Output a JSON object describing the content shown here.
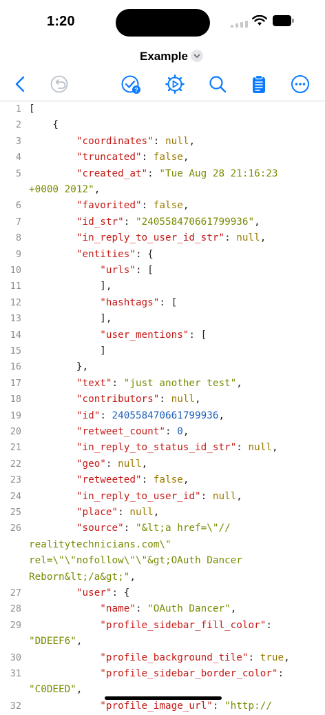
{
  "status_bar": {
    "time": "1:20"
  },
  "header": {
    "title": "Example"
  },
  "toolbar": {
    "icons": [
      "back-chevron-icon",
      "undo-icon",
      "validate-icon",
      "settings-gear-icon",
      "search-icon",
      "clipboard-icon",
      "more-icon"
    ]
  },
  "colors": {
    "accent": "#0a7aff",
    "key": "#c41a16",
    "string": "#7a8a00",
    "number": "#1c5fb8",
    "line_number": "#8e8e93"
  },
  "code_lines": [
    {
      "n": "1",
      "parts": [
        [
          "p",
          "["
        ]
      ]
    },
    {
      "n": "2",
      "parts": [
        [
          "p",
          "    {"
        ]
      ]
    },
    {
      "n": "3",
      "parts": [
        [
          "p",
          "        "
        ],
        [
          "k",
          "\"coordinates\""
        ],
        [
          "p",
          ": "
        ],
        [
          "b",
          "null"
        ],
        [
          "p",
          ","
        ]
      ]
    },
    {
      "n": "4",
      "parts": [
        [
          "p",
          "        "
        ],
        [
          "k",
          "\"truncated\""
        ],
        [
          "p",
          ": "
        ],
        [
          "b",
          "false"
        ],
        [
          "p",
          ","
        ]
      ]
    },
    {
      "n": "5",
      "parts": [
        [
          "p",
          "        "
        ],
        [
          "k",
          "\"created_at\""
        ],
        [
          "p",
          ": "
        ],
        [
          "s",
          "\"Tue Aug 28 21:16:23"
        ]
      ]
    },
    {
      "n": "",
      "parts": [
        [
          "s",
          "+0000 2012\""
        ],
        [
          "p",
          ","
        ]
      ]
    },
    {
      "n": "6",
      "parts": [
        [
          "p",
          "        "
        ],
        [
          "k",
          "\"favorited\""
        ],
        [
          "p",
          ": "
        ],
        [
          "b",
          "false"
        ],
        [
          "p",
          ","
        ]
      ]
    },
    {
      "n": "7",
      "parts": [
        [
          "p",
          "        "
        ],
        [
          "k",
          "\"id_str\""
        ],
        [
          "p",
          ": "
        ],
        [
          "s",
          "\"240558470661799936\""
        ],
        [
          "p",
          ","
        ]
      ]
    },
    {
      "n": "8",
      "parts": [
        [
          "p",
          "        "
        ],
        [
          "k",
          "\"in_reply_to_user_id_str\""
        ],
        [
          "p",
          ": "
        ],
        [
          "b",
          "null"
        ],
        [
          "p",
          ","
        ]
      ]
    },
    {
      "n": "9",
      "parts": [
        [
          "p",
          "        "
        ],
        [
          "k",
          "\"entities\""
        ],
        [
          "p",
          ": {"
        ]
      ]
    },
    {
      "n": "10",
      "parts": [
        [
          "p",
          "            "
        ],
        [
          "k",
          "\"urls\""
        ],
        [
          "p",
          ": ["
        ]
      ]
    },
    {
      "n": "11",
      "parts": [
        [
          "p",
          "            ],"
        ]
      ]
    },
    {
      "n": "12",
      "parts": [
        [
          "p",
          "            "
        ],
        [
          "k",
          "\"hashtags\""
        ],
        [
          "p",
          ": ["
        ]
      ]
    },
    {
      "n": "13",
      "parts": [
        [
          "p",
          "            ],"
        ]
      ]
    },
    {
      "n": "14",
      "parts": [
        [
          "p",
          "            "
        ],
        [
          "k",
          "\"user_mentions\""
        ],
        [
          "p",
          ": ["
        ]
      ]
    },
    {
      "n": "15",
      "parts": [
        [
          "p",
          "            ]"
        ]
      ]
    },
    {
      "n": "16",
      "parts": [
        [
          "p",
          "        },"
        ]
      ]
    },
    {
      "n": "17",
      "parts": [
        [
          "p",
          "        "
        ],
        [
          "k",
          "\"text\""
        ],
        [
          "p",
          ": "
        ],
        [
          "s",
          "\"just another test\""
        ],
        [
          "p",
          ","
        ]
      ]
    },
    {
      "n": "18",
      "parts": [
        [
          "p",
          "        "
        ],
        [
          "k",
          "\"contributors\""
        ],
        [
          "p",
          ": "
        ],
        [
          "b",
          "null"
        ],
        [
          "p",
          ","
        ]
      ]
    },
    {
      "n": "19",
      "parts": [
        [
          "p",
          "        "
        ],
        [
          "k",
          "\"id\""
        ],
        [
          "p",
          ": "
        ],
        [
          "n",
          "240558470661799936"
        ],
        [
          "p",
          ","
        ]
      ]
    },
    {
      "n": "20",
      "parts": [
        [
          "p",
          "        "
        ],
        [
          "k",
          "\"retweet_count\""
        ],
        [
          "p",
          ": "
        ],
        [
          "n",
          "0"
        ],
        [
          "p",
          ","
        ]
      ]
    },
    {
      "n": "21",
      "parts": [
        [
          "p",
          "        "
        ],
        [
          "k",
          "\"in_reply_to_status_id_str\""
        ],
        [
          "p",
          ": "
        ],
        [
          "b",
          "null"
        ],
        [
          "p",
          ","
        ]
      ]
    },
    {
      "n": "22",
      "parts": [
        [
          "p",
          "        "
        ],
        [
          "k",
          "\"geo\""
        ],
        [
          "p",
          ": "
        ],
        [
          "b",
          "null"
        ],
        [
          "p",
          ","
        ]
      ]
    },
    {
      "n": "23",
      "parts": [
        [
          "p",
          "        "
        ],
        [
          "k",
          "\"retweeted\""
        ],
        [
          "p",
          ": "
        ],
        [
          "b",
          "false"
        ],
        [
          "p",
          ","
        ]
      ]
    },
    {
      "n": "24",
      "parts": [
        [
          "p",
          "        "
        ],
        [
          "k",
          "\"in_reply_to_user_id\""
        ],
        [
          "p",
          ": "
        ],
        [
          "b",
          "null"
        ],
        [
          "p",
          ","
        ]
      ]
    },
    {
      "n": "25",
      "parts": [
        [
          "p",
          "        "
        ],
        [
          "k",
          "\"place\""
        ],
        [
          "p",
          ": "
        ],
        [
          "b",
          "null"
        ],
        [
          "p",
          ","
        ]
      ]
    },
    {
      "n": "26",
      "parts": [
        [
          "p",
          "        "
        ],
        [
          "k",
          "\"source\""
        ],
        [
          "p",
          ": "
        ],
        [
          "s",
          "\"&lt;a href=\\\"//"
        ]
      ]
    },
    {
      "n": "",
      "parts": [
        [
          "s",
          "realitytechnicians.com\\\""
        ]
      ]
    },
    {
      "n": "",
      "parts": [
        [
          "s",
          "rel=\\\"\\\"nofollow\\\"\\\"&gt;OAuth Dancer"
        ]
      ]
    },
    {
      "n": "",
      "parts": [
        [
          "s",
          "Reborn&lt;/a&gt;\""
        ],
        [
          "p",
          ","
        ]
      ]
    },
    {
      "n": "27",
      "parts": [
        [
          "p",
          "        "
        ],
        [
          "k",
          "\"user\""
        ],
        [
          "p",
          ": {"
        ]
      ]
    },
    {
      "n": "28",
      "parts": [
        [
          "p",
          "            "
        ],
        [
          "k",
          "\"name\""
        ],
        [
          "p",
          ": "
        ],
        [
          "s",
          "\"OAuth Dancer\""
        ],
        [
          "p",
          ","
        ]
      ]
    },
    {
      "n": "29",
      "parts": [
        [
          "p",
          "            "
        ],
        [
          "k",
          "\"profile_sidebar_fill_color\""
        ],
        [
          "p",
          ":"
        ]
      ]
    },
    {
      "n": "",
      "parts": [
        [
          "s",
          "\"DDEEF6\""
        ],
        [
          "p",
          ","
        ]
      ]
    },
    {
      "n": "30",
      "parts": [
        [
          "p",
          "            "
        ],
        [
          "k",
          "\"profile_background_tile\""
        ],
        [
          "p",
          ": "
        ],
        [
          "b",
          "true"
        ],
        [
          "p",
          ","
        ]
      ]
    },
    {
      "n": "31",
      "parts": [
        [
          "p",
          "            "
        ],
        [
          "k",
          "\"profile_sidebar_border_color\""
        ],
        [
          "p",
          ":"
        ]
      ]
    },
    {
      "n": "",
      "parts": [
        [
          "s",
          "\"C0DEED\""
        ],
        [
          "p",
          ","
        ]
      ]
    },
    {
      "n": "32",
      "parts": [
        [
          "p",
          "            "
        ],
        [
          "k",
          "\"profile_image_url\""
        ],
        [
          "p",
          ": "
        ],
        [
          "s",
          "\"http://"
        ]
      ]
    }
  ]
}
